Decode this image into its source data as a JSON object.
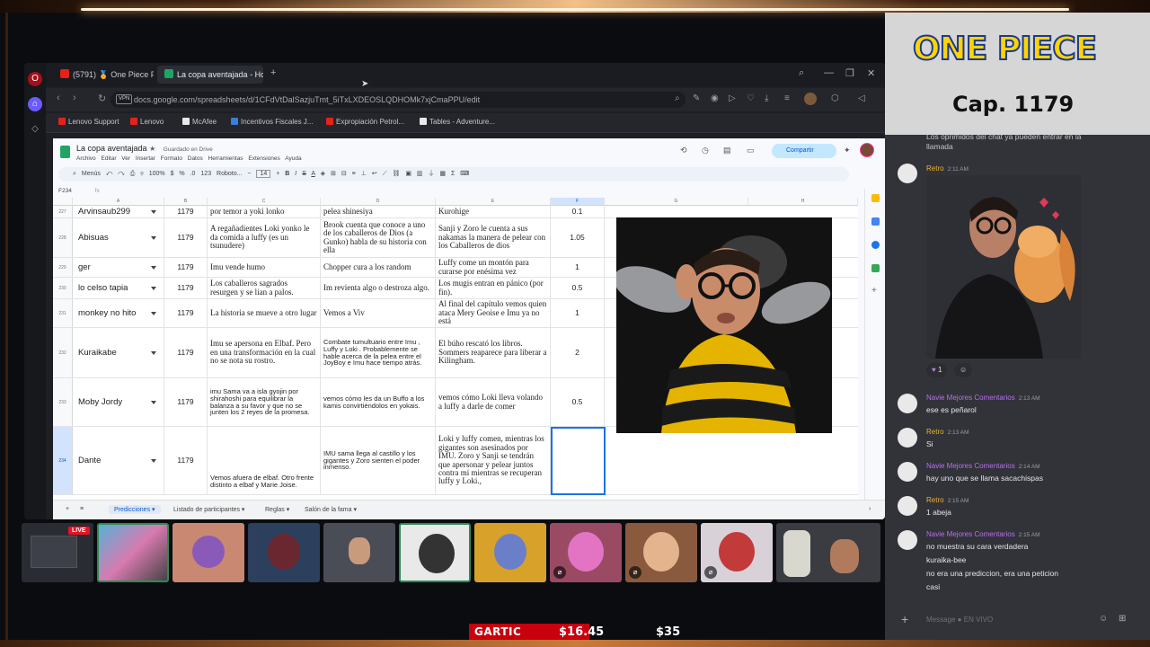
{
  "browser": {
    "tabs": [
      {
        "label": "(5791) 🏅 One Piece POD…"
      },
      {
        "label": "La copa aventajada - Hoj…"
      }
    ],
    "url": "docs.google.com/spreadsheets/d/1CFdVtDalSazjuTmt_5iTxLXDEOSLQDHOMk7xjCmaPPU/edit",
    "vpn": "VPN",
    "bookmarks": [
      "Lenovo Support",
      "Lenovo",
      "McAfee",
      "Incentivos Fiscales J...",
      "Expropiación Petrol...",
      "Tables - Adventure..."
    ]
  },
  "sheet": {
    "title": "La copa aventajada",
    "saved": "Guardado en Drive",
    "menu": [
      "Archivo",
      "Editar",
      "Ver",
      "Insertar",
      "Formato",
      "Datos",
      "Herramientas",
      "Extensiones",
      "Ayuda"
    ],
    "share": "Compartir",
    "toolbar": {
      "menus": "Menús",
      "zoom": "100%",
      "font": "Roboto...",
      "size": "14"
    },
    "namebox": "F234",
    "fx": "fx",
    "columns": [
      "A",
      "B",
      "C",
      "D",
      "E",
      "F",
      "G",
      "H"
    ],
    "rows": [
      {
        "n": "227",
        "name": "Arvinsaub299",
        "cap": "1179",
        "c": "por temor a yoki lonko",
        "d": "pelea shinesiya",
        "e": "Kurohige",
        "f": "0.1"
      },
      {
        "n": "228",
        "name": "Abisuas",
        "cap": "1179",
        "c": "A regañadientes Loki yonko le da comida a luffy (es un tsunudere)",
        "d": "Brook cuenta que conoce a uno de los caballeros de Dios (a Gunko) habla de su historia  con ella",
        "e": "Sanji y Zoro le cuenta a sus nakamas la manera de pelear con los Caballeros de dios",
        "f": "1.05"
      },
      {
        "n": "229",
        "name": "ger",
        "cap": "1179",
        "c": " Imu vende humo",
        "d": "Chopper cura a los random",
        "e": "Luffy come un montón para curarse por enésima vez",
        "f": "1"
      },
      {
        "n": "230",
        "name": "lo celso tapia",
        "cap": "1179",
        "c": "Los caballeros sagrados resurgen y se lían a palos.",
        "d": "Im revienta algo o destroza algo.",
        "e": "Los mugis entran en pánico (por fin).",
        "f": "0.5"
      },
      {
        "n": "231",
        "name": "monkey no hito",
        "cap": "1179",
        "c": "La historia se mueve a otro lugar",
        "d": "Vemos a Viv",
        "e": "Al final del capítulo vemos quien ataca Mery Geoise e Imu ya no está",
        "f": "1"
      },
      {
        "n": "232",
        "name": "Kuraikabe",
        "cap": "1179",
        "c": " Imu se apersona en Elbaf. Pero en una transformación en la cual no se nota su rostro.",
        "d": "Combate tumultuario entre Imu , Luffy y Loki . Probablemente se hable acerca de la pelea entre el JoyBoy e Imu hace tiempo atrás.",
        "e": " El búho rescató  los libros. Sommers reaparece para liberar a  Kilingham.",
        "f": "2"
      },
      {
        "n": "233",
        "name": "Moby Jordy",
        "cap": "1179",
        "c": " imu Sama va a isla gyojin por shirahoshi para equilibrar la balanza a su favor y que no se junten los 2 reyes de la promesa.",
        "d": "vemos cómo  les da un Buffo a los kamis convirtiéndolos en yokais.",
        "e": "vemos cómo Loki lleva volando a luffy a  darle de comer",
        "f": "0.5"
      },
      {
        "n": "234",
        "name": "Dante",
        "cap": "1179",
        "c": "Vemos afuera de elbaf. Otro frente distinto a elbaf y Marie Joise.",
        "d": "IMU sama llega al castillo y los gigantes y Zoro sienten el poder inmenso.",
        "e": "Loki y luffy comen, mientras los gigantes son asesinados por IMU. Zoro y Sanji se tendrán que apersonar y pelear juntos contra mi mientras se recuperan luffy y Loki.,",
        "f": ""
      }
    ],
    "tabs": [
      "Predicciones",
      "Listado de participantes",
      "Reglas",
      "Salón de la fama"
    ]
  },
  "overlay": {
    "show_title": "ONE PIECE",
    "chapter": "Cap. 1179",
    "gartic": {
      "label": "GARTIC",
      "raised": "$16.45",
      "goal": "$35",
      "progress": 0.47
    }
  },
  "chat": {
    "top_text": [
      "Los oprimidos del chat ya pueden entrar en la",
      "llamada"
    ],
    "messages": [
      {
        "user": "Retro",
        "time": "2:11 AM",
        "color": "#f0b232",
        "text": ""
      },
      {
        "user": "Navie Mejores Comentarios",
        "time": "2:13 AM",
        "color": "#b86ef2",
        "text": "ese es peñarol"
      },
      {
        "user": "Retro",
        "time": "2:13 AM",
        "color": "#f0b232",
        "text": "Si"
      },
      {
        "user": "Navie Mejores Comentarios",
        "time": "2:14 AM",
        "color": "#b86ef2",
        "text": "hay uno que se llama sacachispas"
      },
      {
        "user": "Retro",
        "time": "2:15 AM",
        "color": "#f0b232",
        "text": "1 abeja"
      },
      {
        "user": "Navie Mejores Comentarios",
        "time": "2:15 AM",
        "color": "#b86ef2",
        "text": "no muestra su cara verdadera"
      }
    ],
    "extra_lines": [
      "kuraika-bee",
      "no era una prediccion, era una peticion",
      "casi"
    ],
    "reaction_count": "1",
    "input_placeholder": "Message ● EN VIVO"
  },
  "strip": {
    "live_label": "LIVE"
  }
}
